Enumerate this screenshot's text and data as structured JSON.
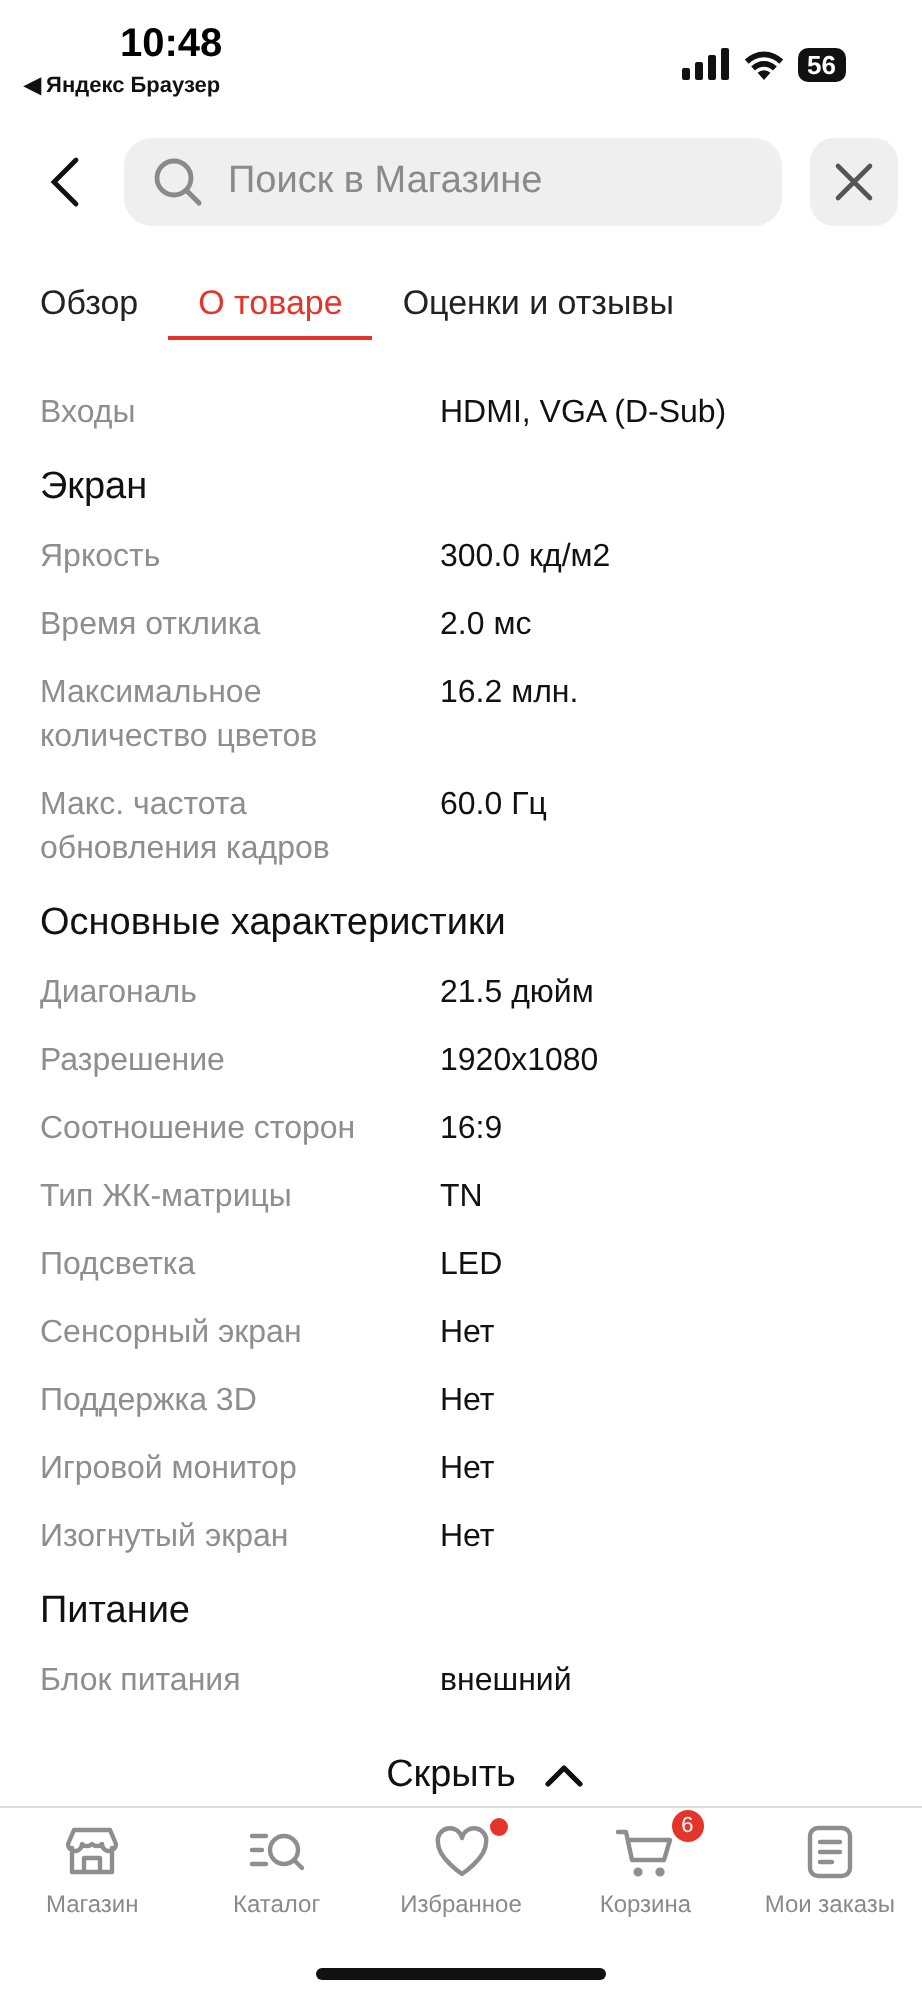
{
  "status_bar": {
    "time": "10:48",
    "back_app": "◀ Яндекс Браузер",
    "battery": "56"
  },
  "search": {
    "placeholder": "Поиск в Магазине"
  },
  "tabs": [
    {
      "label": "Обзор",
      "selected": false
    },
    {
      "label": "О товаре",
      "selected": true
    },
    {
      "label": "Оценки и отзывы",
      "selected": false
    }
  ],
  "spec_sections": [
    {
      "rows": [
        {
          "label": "Входы",
          "value": "HDMI, VGA (D-Sub)"
        }
      ]
    },
    {
      "title": "Экран",
      "rows": [
        {
          "label": "Яркость",
          "value": "300.0 кд/м2"
        },
        {
          "label": "Время отклика",
          "value": "2.0 мс"
        },
        {
          "label": "Максимальное количество цветов",
          "value": "16.2 млн."
        },
        {
          "label": "Макс. частота обновления кадров",
          "value": "60.0 Гц"
        }
      ]
    },
    {
      "title": "Основные характеристики",
      "rows": [
        {
          "label": "Диагональ",
          "value": "21.5 дюйм"
        },
        {
          "label": "Разрешение",
          "value": "1920x1080"
        },
        {
          "label": "Соотношение сторон",
          "value": "16:9"
        },
        {
          "label": "Тип ЖК-матрицы",
          "value": "TN"
        },
        {
          "label": "Подсветка",
          "value": "LED"
        },
        {
          "label": "Сенсорный экран",
          "value": "Нет"
        },
        {
          "label": "Поддержка 3D",
          "value": "Нет"
        },
        {
          "label": "Игровой монитор",
          "value": "Нет"
        },
        {
          "label": "Изогнутый экран",
          "value": "Нет"
        }
      ]
    },
    {
      "title": "Питание",
      "rows": [
        {
          "label": "Блок питания",
          "value": "внешний"
        }
      ]
    }
  ],
  "collapse": {
    "label": "Скрыть"
  },
  "bottom_nav": [
    {
      "label": "Магазин",
      "kind": "store"
    },
    {
      "label": "Каталог",
      "kind": "catalog"
    },
    {
      "label": "Избранное",
      "kind": "heart",
      "dot": true
    },
    {
      "label": "Корзина",
      "kind": "cart",
      "badge": "6"
    },
    {
      "label": "Мои заказы",
      "kind": "orders"
    }
  ]
}
